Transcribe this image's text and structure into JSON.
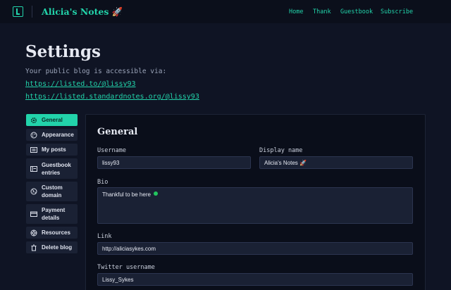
{
  "header": {
    "site_title": "Alicia's Notes 🚀",
    "nav": [
      "Home",
      "Thank",
      "Guestbook",
      "Subscribe"
    ]
  },
  "page": {
    "title": "Settings",
    "intro": "Your public blog is accessible via:",
    "links": [
      "https://listed.to/@lissy93",
      "https://listed.standardnotes.org/@lissy93"
    ]
  },
  "sidebar": {
    "items": [
      {
        "label": "General",
        "icon": "gear-icon",
        "active": true
      },
      {
        "label": "Appearance",
        "icon": "palette-icon",
        "active": false
      },
      {
        "label": "My posts",
        "icon": "list-icon",
        "active": false
      },
      {
        "label": "Guestbook entries",
        "icon": "book-icon",
        "active": false
      },
      {
        "label": "Custom domain",
        "icon": "globe-icon",
        "active": false
      },
      {
        "label": "Payment details",
        "icon": "credit-card-icon",
        "active": false
      },
      {
        "label": "Resources",
        "icon": "lifebuoy-icon",
        "active": false
      },
      {
        "label": "Delete blog",
        "icon": "trash-icon",
        "active": false
      }
    ]
  },
  "form": {
    "title": "General",
    "username": {
      "label": "Username",
      "value": "lissy93"
    },
    "display_name": {
      "label": "Display name",
      "value": "Alicia's Notes 🚀"
    },
    "bio": {
      "label": "Bio",
      "value": "Thankful to be here"
    },
    "link": {
      "label": "Link",
      "value": "http://aliciasykes.com"
    },
    "twitter": {
      "label": "Twitter username",
      "value": "Lissy_Sykes"
    }
  },
  "colors": {
    "accent": "#22d3aa",
    "background": "#0f1424",
    "input_bg": "#1a2134"
  }
}
